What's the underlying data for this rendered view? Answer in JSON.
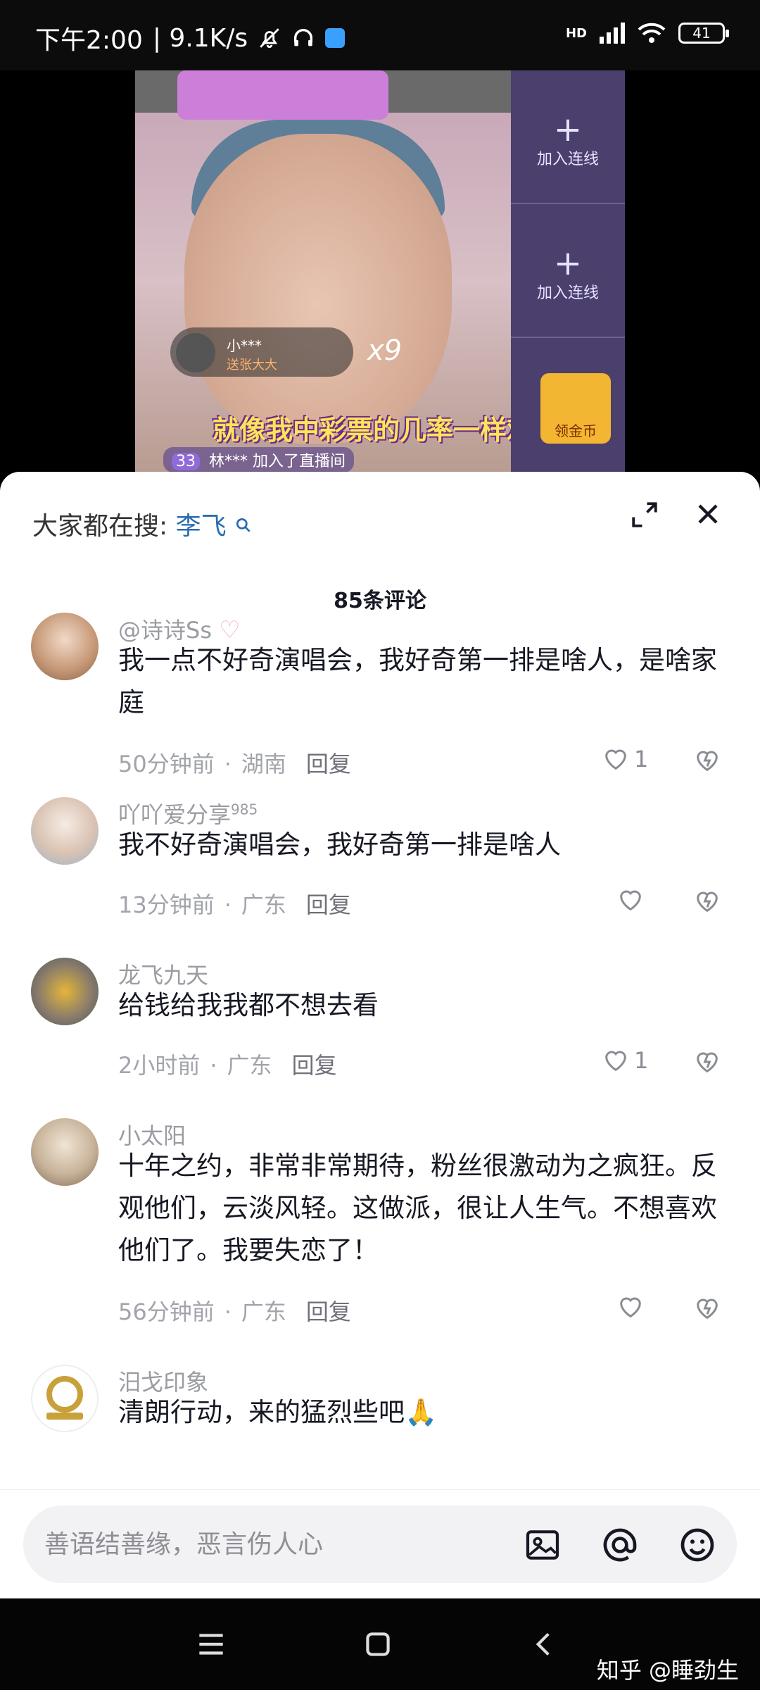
{
  "status_bar": {
    "time": "下午2:00",
    "speed": "| 9.1K/s",
    "network": "HD",
    "battery": "41"
  },
  "video": {
    "slot_label_1": "加入连线",
    "slot_label_2": "加入连线",
    "gift_user": "小***",
    "gift_sub": "送张大大",
    "multiplier": "x9",
    "subtitle": "就像我中彩票的几率一样难",
    "join_text": "林*** 加入了直播间",
    "join_level": "33",
    "coin_label": "领金币"
  },
  "sheet": {
    "search_prefix": "大家都在搜:",
    "search_term": "李飞",
    "comment_count": "85条评论"
  },
  "comments": [
    {
      "username": "@诗诗Ss",
      "text": "我一点不好奇演唱会，我好奇第一排是啥人，是啥家庭",
      "time": "50分钟前",
      "location": "湖南",
      "reply": "回复",
      "likes": "1"
    },
    {
      "username": "吖吖爱分享",
      "username_sup": "985",
      "text": "我不好奇演唱会，我好奇第一排是啥人",
      "time": "13分钟前",
      "location": "广东",
      "reply": "回复",
      "likes": ""
    },
    {
      "username": "龙飞九天",
      "text": "给钱给我我都不想去看",
      "time": "2小时前",
      "location": "广东",
      "reply": "回复",
      "likes": "1"
    },
    {
      "username": "小太阳",
      "text": "十年之约，非常非常期待，粉丝很激动为之疯狂。反观他们，云淡风轻。这做派，很让人生气。不想喜欢他们了。我要失恋了！",
      "time": "56分钟前",
      "location": "广东",
      "reply": "回复",
      "likes": ""
    },
    {
      "username": "汨戈印象",
      "text": "清朗行动，来的猛烈些吧🙏",
      "time": "",
      "location": "",
      "reply": "",
      "likes": ""
    }
  ],
  "input": {
    "placeholder": "善语结善缘，恶言伤人心"
  },
  "watermark": "知乎 @睡劲生"
}
